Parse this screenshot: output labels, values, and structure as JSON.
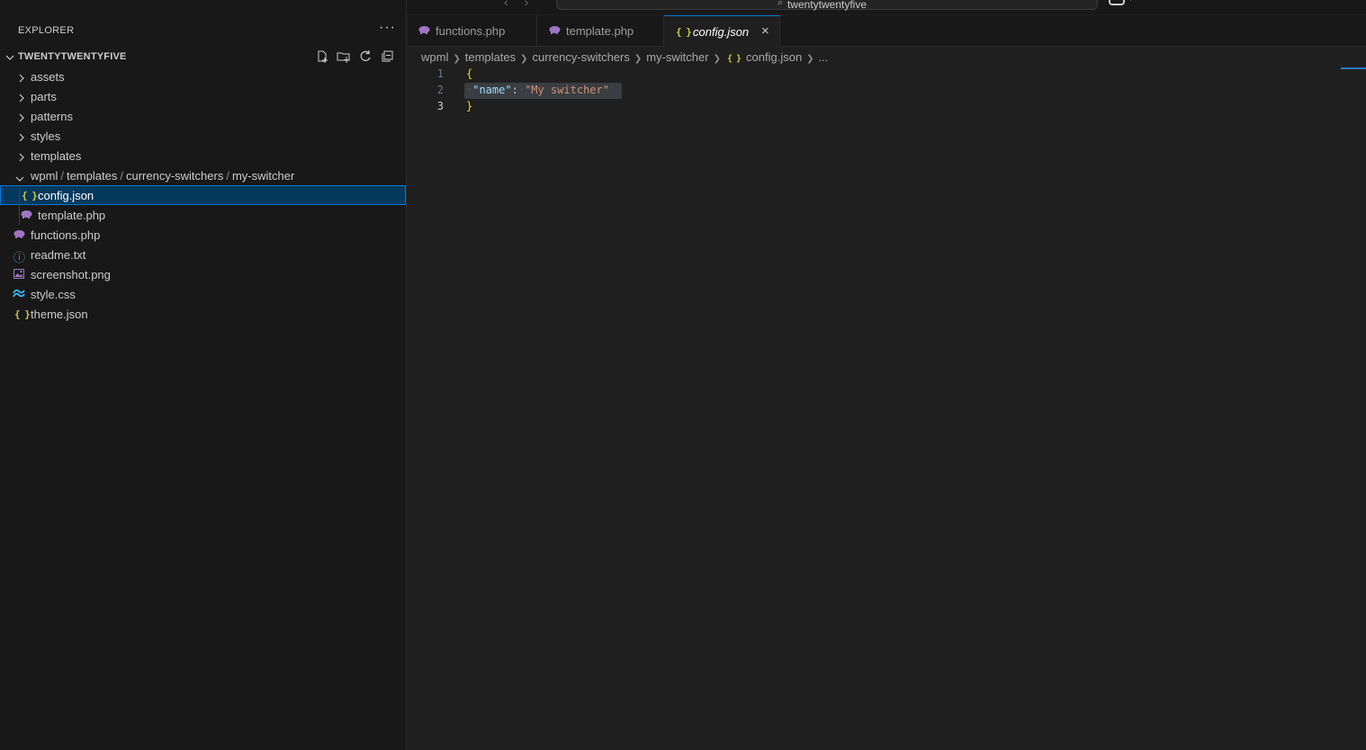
{
  "titlebar": {
    "search_text": "twentytwentyfive",
    "nav_back": "‹",
    "nav_forward": "›"
  },
  "sidebar": {
    "header": "EXPLORER",
    "more": "···",
    "root": "TWENTYTWENTYFIVE",
    "actions": [
      "new-file",
      "new-folder",
      "refresh",
      "collapse-all"
    ],
    "items": [
      {
        "label": "assets",
        "type": "folder",
        "expanded": false
      },
      {
        "label": "parts",
        "type": "folder",
        "expanded": false
      },
      {
        "label": "patterns",
        "type": "folder",
        "expanded": false
      },
      {
        "label": "styles",
        "type": "folder",
        "expanded": false
      },
      {
        "label": "templates",
        "type": "folder",
        "expanded": false
      },
      {
        "label_parts": [
          "wpml",
          "templates",
          "currency-switchers",
          "my-switcher"
        ],
        "sep": "/",
        "type": "folder",
        "expanded": true
      },
      {
        "label": "config.json",
        "type": "json",
        "selected": true
      },
      {
        "label": "template.php",
        "type": "php"
      },
      {
        "label": "functions.php",
        "type": "php"
      },
      {
        "label": "readme.txt",
        "type": "info"
      },
      {
        "label": "screenshot.png",
        "type": "image"
      },
      {
        "label": "style.css",
        "type": "css"
      },
      {
        "label": "theme.json",
        "type": "json"
      }
    ]
  },
  "tabs": [
    {
      "label": "functions.php",
      "icon": "php-icon",
      "active": false
    },
    {
      "label": "template.php",
      "icon": "php-icon",
      "active": false
    },
    {
      "label": "config.json",
      "icon": "json-icon",
      "active": true,
      "close": "×"
    }
  ],
  "breadcrumb": {
    "parts": [
      "wpml",
      "templates",
      "currency-switchers",
      "my-switcher",
      "config.json",
      "..."
    ]
  },
  "editor": {
    "lines": [
      {
        "num": "1",
        "text": "{"
      },
      {
        "num": "2",
        "key": "\"name\"",
        "colon": ":",
        "value": "\"My switcher\""
      },
      {
        "num": "3",
        "text": "}"
      }
    ]
  },
  "icons": {
    "json": "{}",
    "php": "php-elephant",
    "info": "ⓘ",
    "image": "image",
    "css": "tailwind-wave"
  },
  "colors": {
    "accent": "#0078d4",
    "selected_bg": "#04395e",
    "json_brace": "#cbcb41",
    "php": "#a074c4",
    "key": "#9cdcfe",
    "string": "#ce9178"
  }
}
